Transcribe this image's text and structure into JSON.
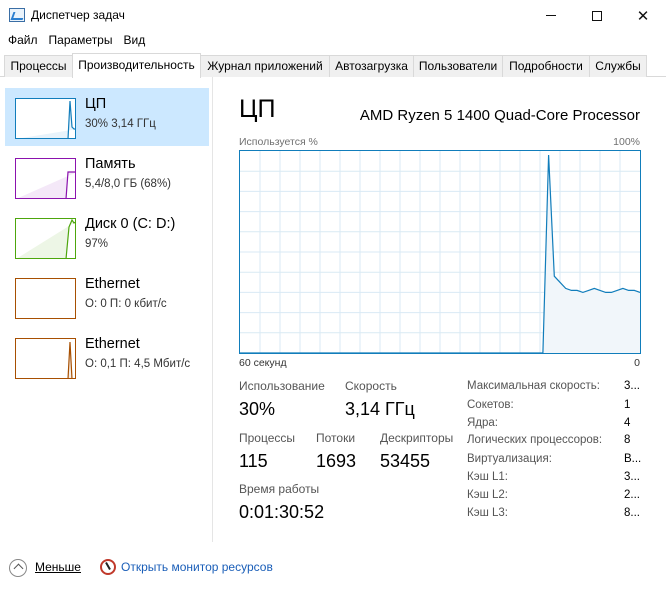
{
  "window": {
    "title": "Диспетчер задач",
    "minimize_icon": "minimize-icon",
    "maximize_icon": "maximize-icon",
    "close_icon": "close-icon",
    "close_glyph": "✕"
  },
  "menu": [
    "Файл",
    "Параметры",
    "Вид"
  ],
  "tabs": [
    {
      "label": "Процессы",
      "active": false
    },
    {
      "label": "Производительность",
      "active": true
    },
    {
      "label": "Журнал приложений",
      "active": false
    },
    {
      "label": "Автозагрузка",
      "active": false
    },
    {
      "label": "Пользователи",
      "active": false
    },
    {
      "label": "Подробности",
      "active": false
    },
    {
      "label": "Службы",
      "active": false
    }
  ],
  "sidebar": {
    "items": [
      {
        "title": "ЦП",
        "subtitle": "30% 3,14 ГГц",
        "color": "#117dbb",
        "selected": true
      },
      {
        "title": "Память",
        "subtitle": "5,4/8,0 ГБ (68%)",
        "color": "#8b12ae",
        "selected": false
      },
      {
        "title": "Диск 0 (C: D:)",
        "subtitle": "97%",
        "color": "#4da60c",
        "selected": false
      },
      {
        "title": "Ethernet",
        "subtitle": "О: 0 П: 0 кбит/с",
        "color": "#a74f01",
        "selected": false
      },
      {
        "title": "Ethernet",
        "subtitle": "О: 0,1 П: 4,5 Мбит/с",
        "color": "#a74f01",
        "selected": false
      }
    ]
  },
  "main": {
    "title": "ЦП",
    "model": "AMD Ryzen 5 1400 Quad-Core Processor",
    "graph_label_left": "Используется %",
    "graph_label_right": "100%",
    "axis_left": "60 секунд",
    "axis_right": "0",
    "stats": {
      "usage_label": "Использование",
      "usage_value": "30%",
      "speed_label": "Скорость",
      "speed_value": "3,14 ГГц",
      "processes_label": "Процессы",
      "processes_value": "115",
      "threads_label": "Потоки",
      "threads_value": "1693",
      "handles_label": "Дескрипторы",
      "handles_value": "53455",
      "uptime_label": "Время работы",
      "uptime_value": "0:01:30:52"
    },
    "details": [
      {
        "label": "Максимальная скорость:",
        "value": "3..."
      },
      {
        "label": "Сокетов:",
        "value": "1"
      },
      {
        "label": "Ядра:",
        "value": "4"
      },
      {
        "label": "Логических процессоров:",
        "value": "8"
      },
      {
        "label": "Виртуализация:",
        "value": "В..."
      },
      {
        "label": "Кэш L1:",
        "value": "3..."
      },
      {
        "label": "Кэш L2:",
        "value": "2..."
      },
      {
        "label": "Кэш L3:",
        "value": "8..."
      }
    ]
  },
  "chart_data": {
    "type": "area",
    "ylabel": "Используется %",
    "xlabel": "60 секунд",
    "ylim": [
      0,
      100
    ],
    "x_range_seconds": [
      60,
      0
    ],
    "grid": true,
    "color": "#117dbb",
    "values": [
      0,
      0,
      0,
      0,
      0,
      0,
      0,
      0,
      0,
      0,
      0,
      0,
      0,
      0,
      0,
      0,
      0,
      0,
      0,
      0,
      0,
      0,
      0,
      0,
      0,
      0,
      0,
      0,
      0,
      0,
      0,
      0,
      0,
      0,
      0,
      0,
      0,
      0,
      0,
      0,
      0,
      0,
      0,
      0,
      0,
      0,
      0,
      0,
      0,
      0,
      0,
      0,
      0,
      0,
      98,
      38,
      35,
      32,
      31,
      31,
      30,
      31,
      32,
      31,
      30,
      30,
      31,
      32,
      31,
      31,
      30
    ]
  },
  "footer": {
    "less_label": "Меньше",
    "monitor_label": "Открыть монитор ресурсов"
  }
}
